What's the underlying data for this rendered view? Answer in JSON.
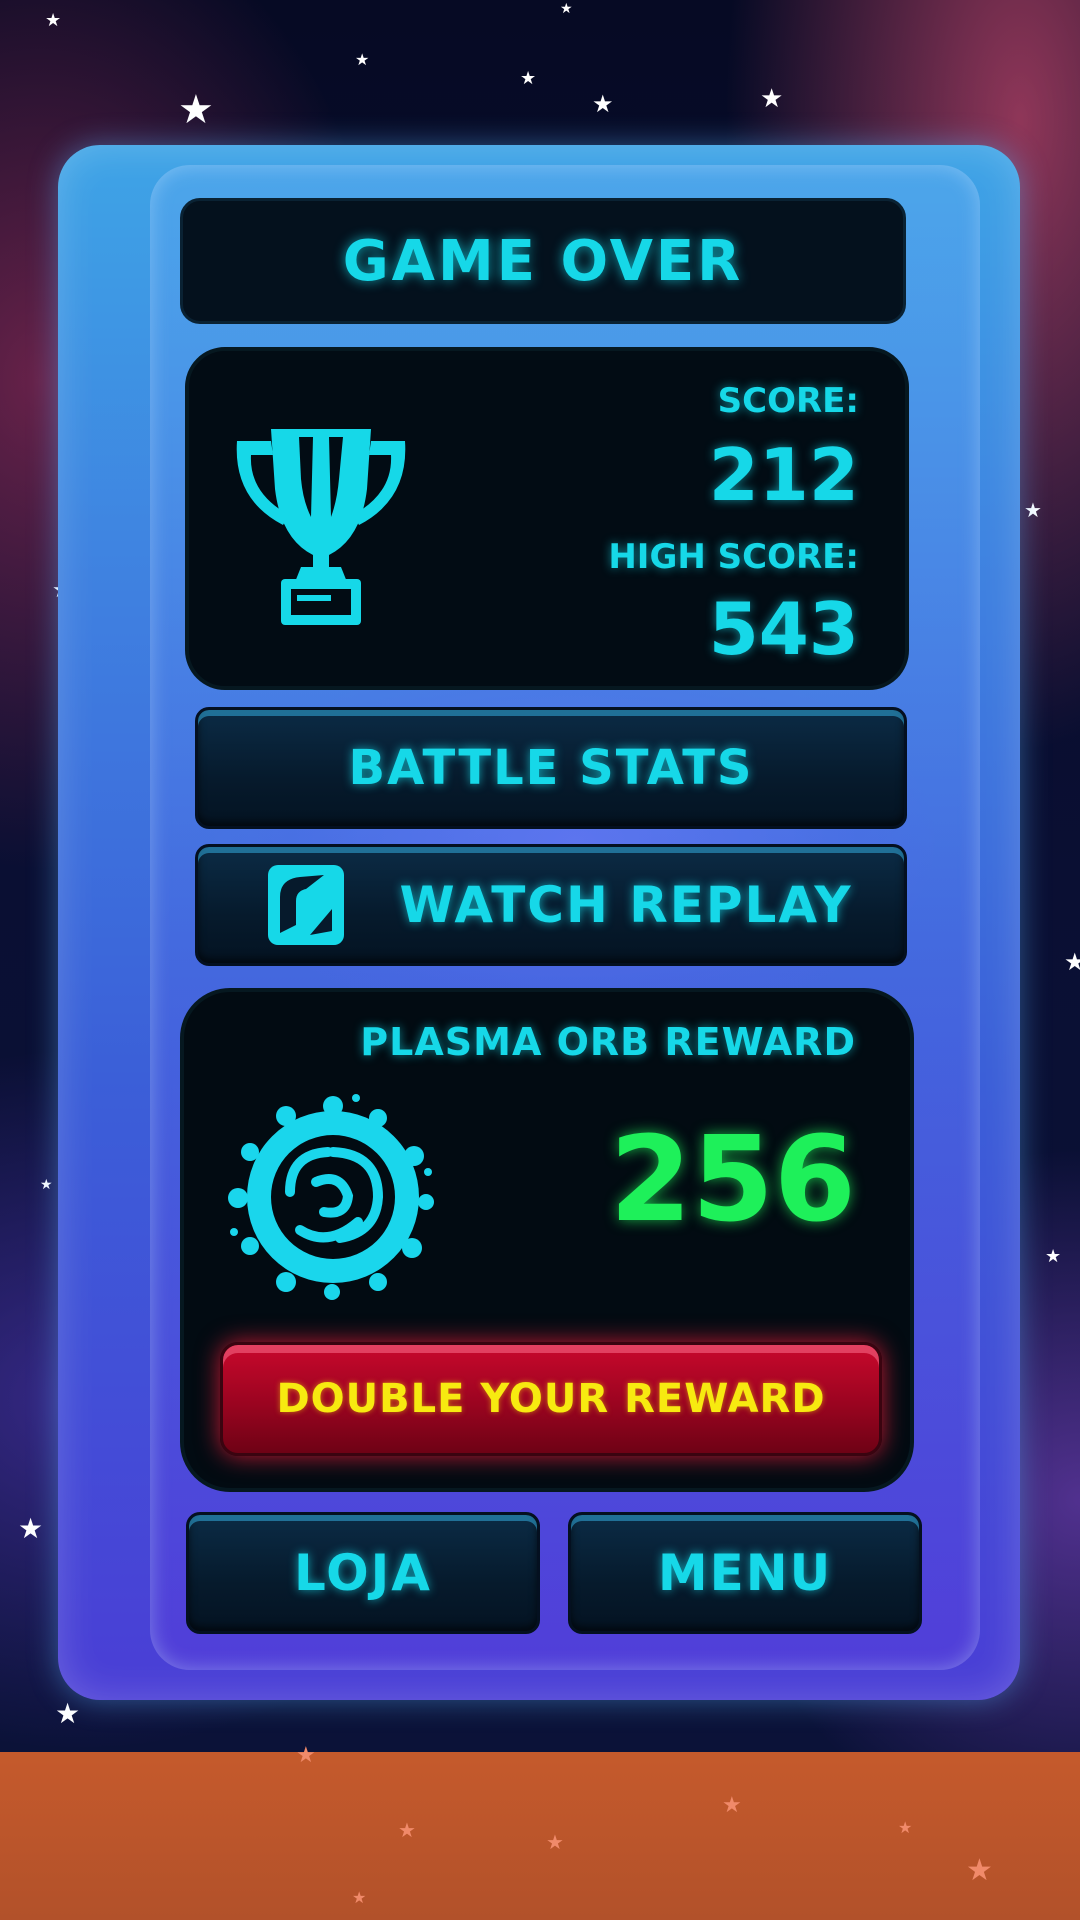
{
  "title": "GAME OVER",
  "score": {
    "label": "SCORE:",
    "value": "212"
  },
  "high_score": {
    "label": "HIGH SCORE:",
    "value": "543"
  },
  "buttons": {
    "battle_stats": "BATTLE STATS",
    "watch_replay": "WATCH REPLAY",
    "double_reward": "DOUBLE YOUR REWARD",
    "shop": "LOJA",
    "menu": "MENU"
  },
  "reward": {
    "label": "PLASMA ORB REWARD",
    "value": "256"
  },
  "icons": [
    "trophy-icon",
    "replay-icon",
    "plasma-orb-icon",
    "star-icon"
  ],
  "colors": {
    "accent_cyan": "#16d8e8",
    "reward_green": "#1ef05a",
    "double_button_red": "#c8082c",
    "double_button_text": "#f7ea10",
    "ground": "#c55a2c"
  }
}
